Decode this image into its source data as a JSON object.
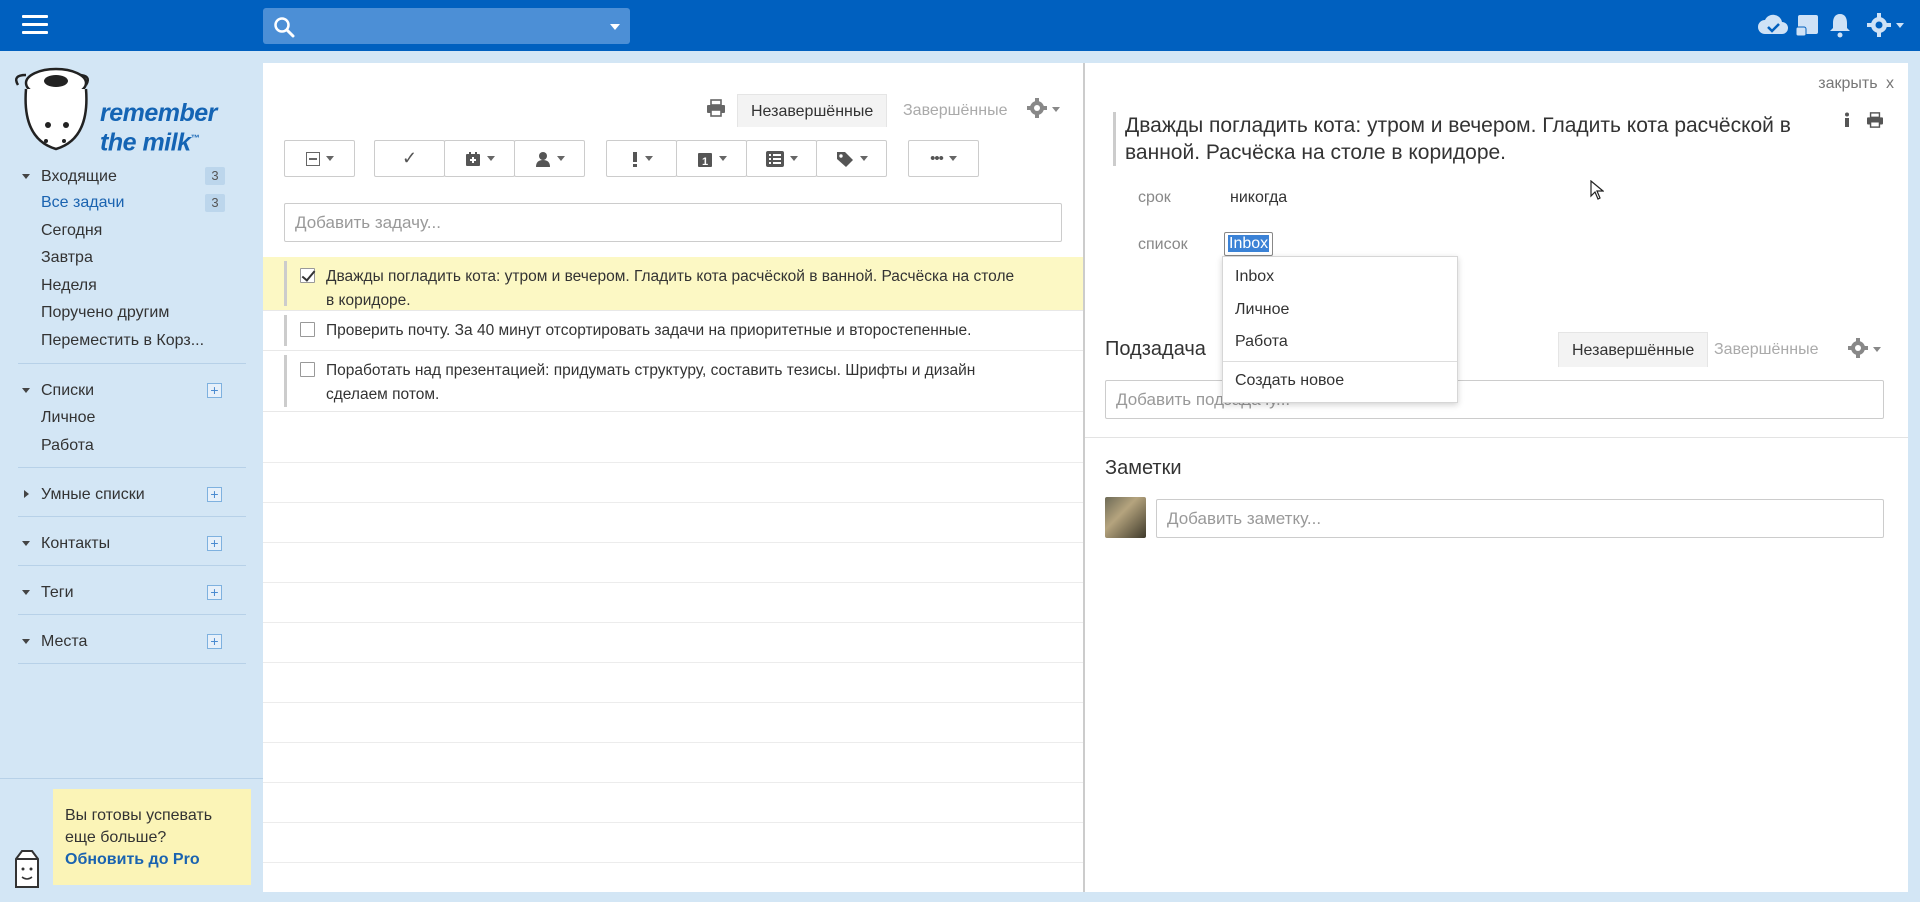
{
  "search": {
    "placeholder": ""
  },
  "sidebar": {
    "logo": "remember the milk",
    "inbox": {
      "label": "Входящие",
      "count": "3"
    },
    "inbox_items": [
      {
        "label": "Все задачи",
        "count": "3"
      },
      {
        "label": "Сегодня"
      },
      {
        "label": "Завтра"
      },
      {
        "label": "Неделя"
      },
      {
        "label": "Поручено другим"
      },
      {
        "label": "Переместить в Корз..."
      }
    ],
    "lists": {
      "label": "Списки",
      "items": [
        "Личное",
        "Работа"
      ]
    },
    "smart_lists": {
      "label": "Умные списки"
    },
    "contacts": {
      "label": "Контакты"
    },
    "tags": {
      "label": "Теги"
    },
    "places": {
      "label": "Места"
    },
    "plus": "+",
    "promo": {
      "line1": "Вы готовы успевать",
      "line2": "еще больше?",
      "link": "Обновить до Pro"
    }
  },
  "list": {
    "tab_incomplete": "Незавершённые",
    "tab_completed": "Завершённые",
    "toolbar": {
      "complete": "✓",
      "more": "•••"
    },
    "add_task_placeholder": "Добавить задачу...",
    "tasks": [
      {
        "text": "Дважды погладить кота: утром и вечером. Гладить кота расчёской в ванной. Расчёска на столе в коридоре.",
        "checked": true,
        "selected": true
      },
      {
        "text": "Проверить почту. За 40 минут отсортировать задачи на приоритетные и второстепенные.",
        "checked": false,
        "selected": false
      },
      {
        "text": "Поработать над презентацией: придумать структуру, составить тезисы. Шрифты и дизайн сделаем потом.",
        "checked": false,
        "selected": false
      }
    ]
  },
  "detail": {
    "close": "закрыть",
    "close_x": "x",
    "title": "Дважды погладить кота: утром и вечером. Гладить кота расчёской в ванной. Расчёска на столе в коридоре.",
    "due_label": "срок",
    "due_value": "никогда",
    "list_label": "список",
    "list_value": "Inbox",
    "subtask_title": "Подзадача",
    "sub_tab_incomplete": "Незавершённые",
    "sub_tab_completed": "Завершённые",
    "subtask_placeholder": "Добавить подзадачу...",
    "notes_title": "Заметки",
    "note_placeholder": "Добавить заметку..."
  },
  "dropdown": {
    "options": [
      "Inbox",
      "Личное",
      "Работа"
    ],
    "create_new": "Создать новое"
  },
  "colors": {
    "topbar": "#0060bf",
    "sidebar": "#d3e6f5",
    "accent": "#1a63b0",
    "selected_row": "#fcf8c4",
    "promo": "#fbf4b7"
  }
}
